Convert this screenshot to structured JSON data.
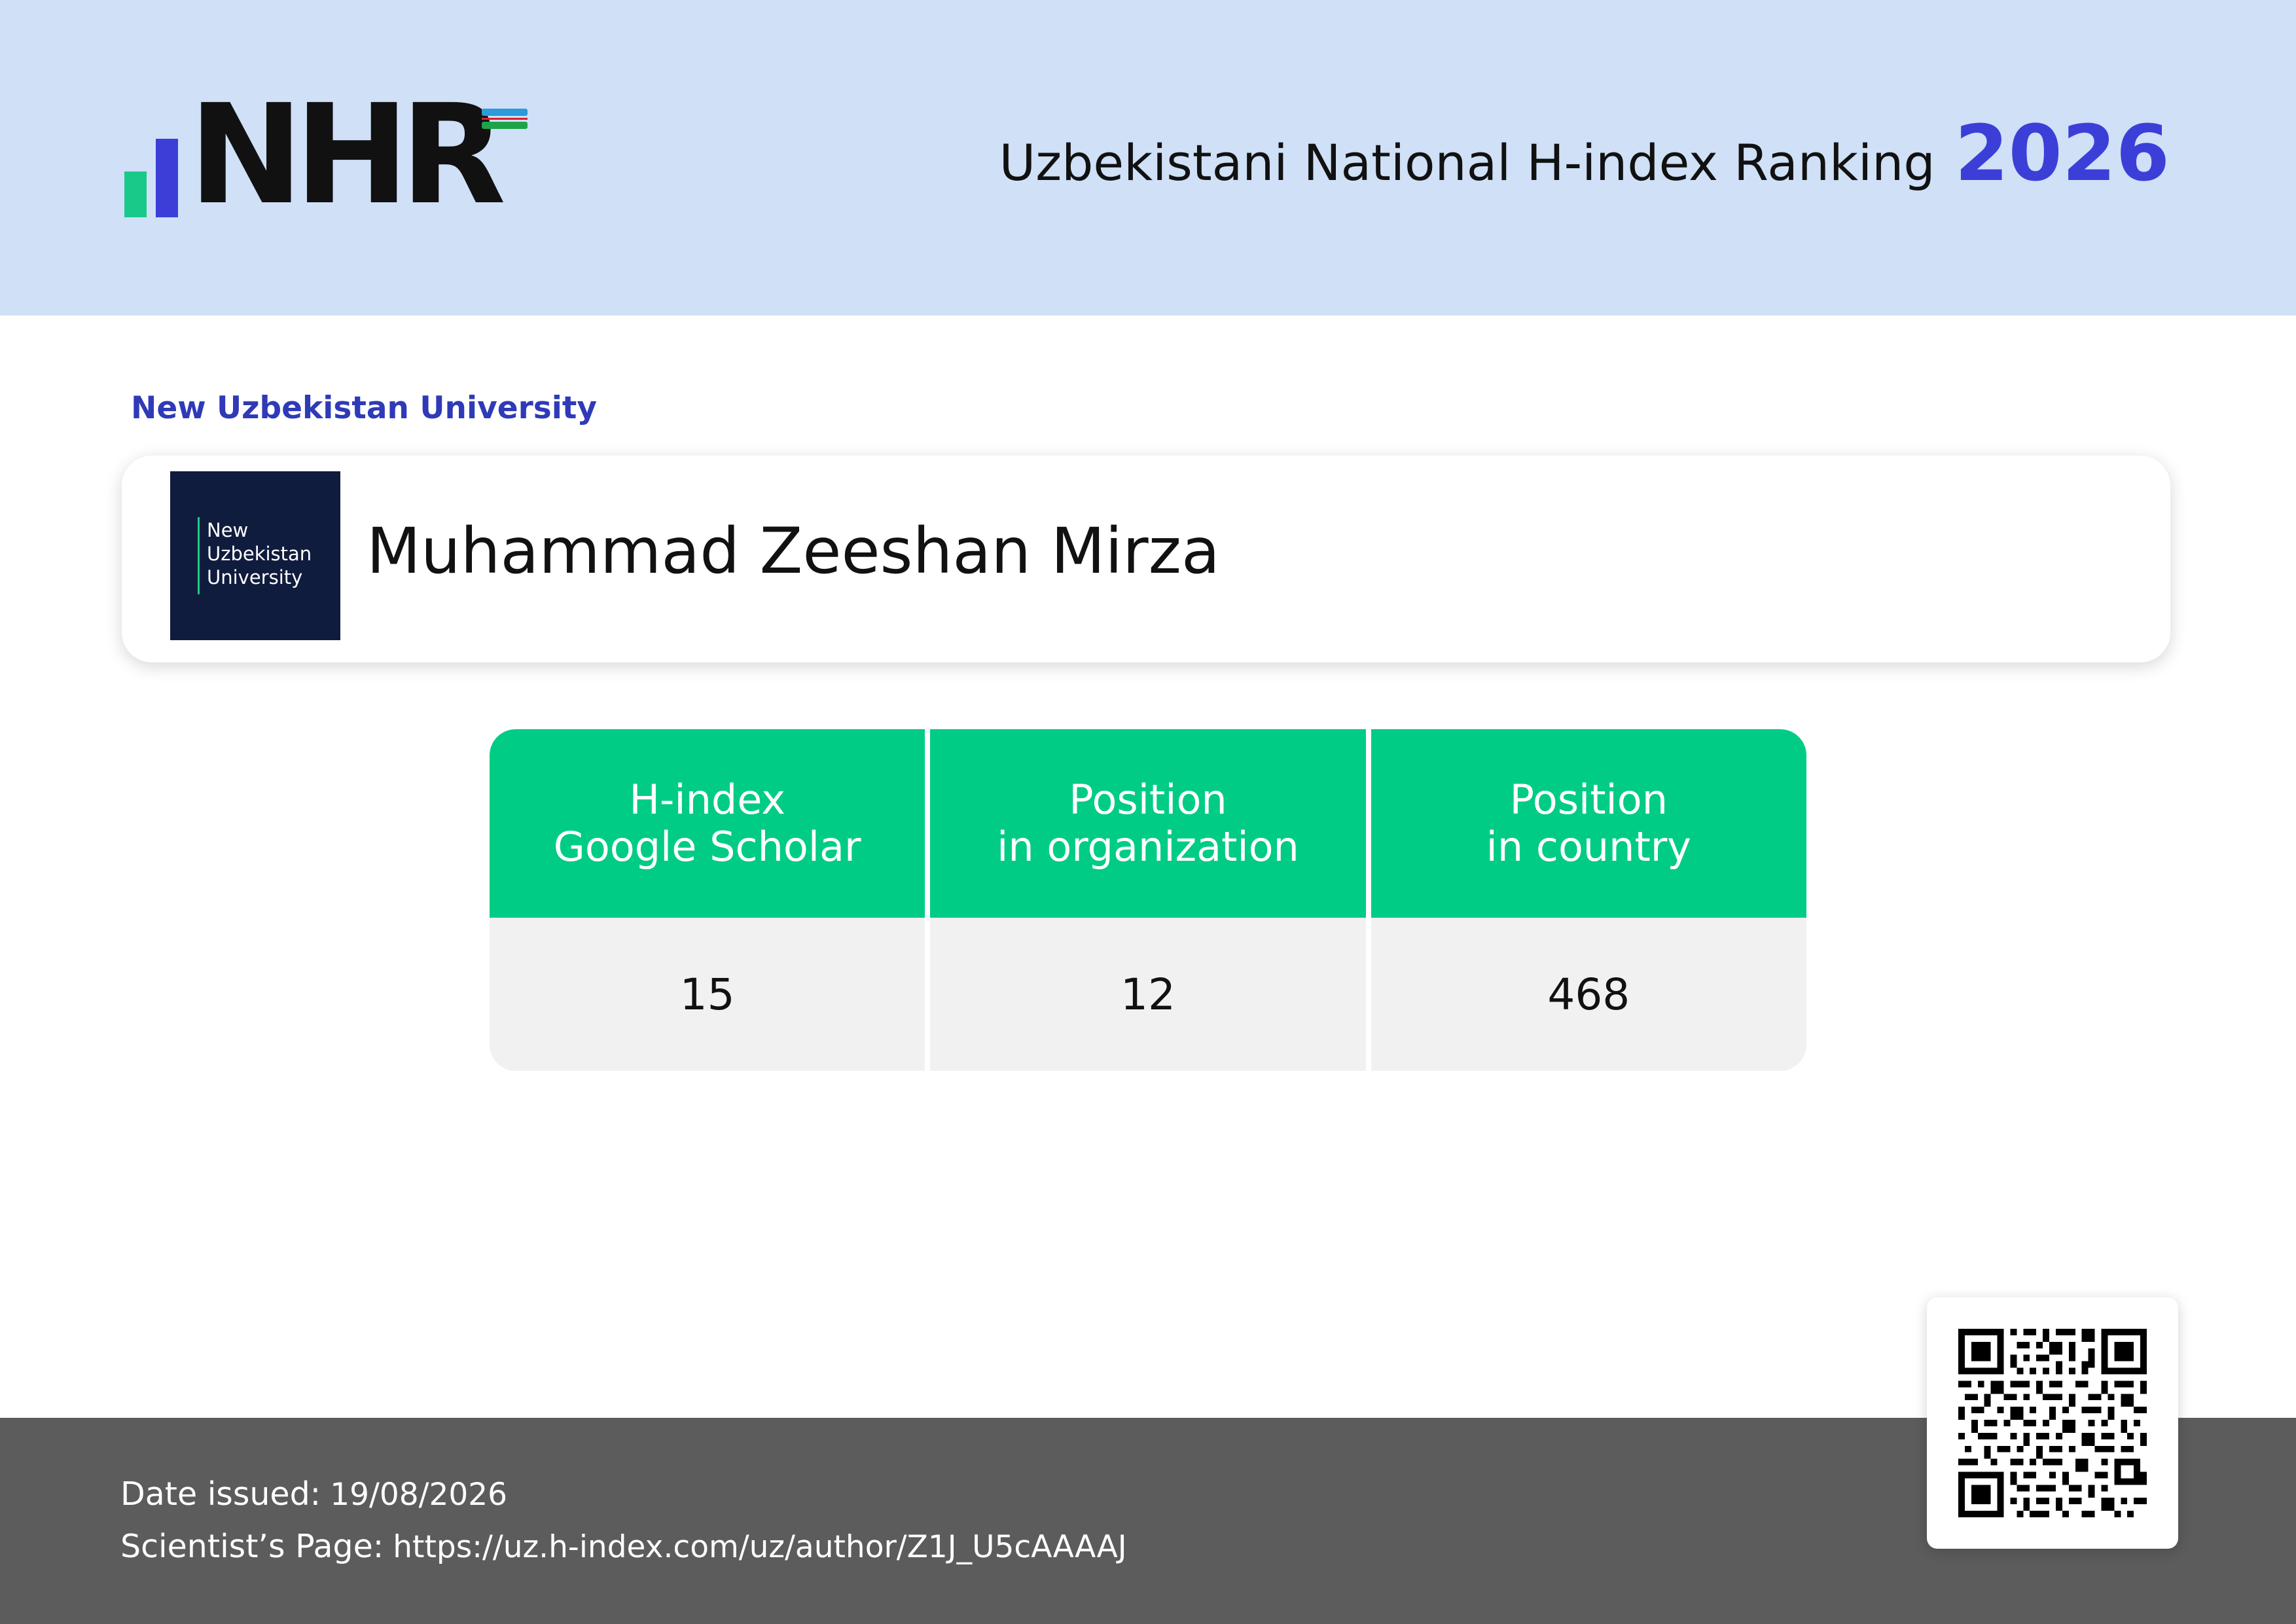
{
  "header": {
    "logo_text": "NHR",
    "title": "Uzbekistani National H-index Ranking",
    "year": "2026"
  },
  "organization": {
    "label": "New Uzbekistan University",
    "logo_lines": [
      "New",
      "Uzbekistan",
      "University"
    ]
  },
  "scientist": {
    "name": "Muhammad Zeeshan Mirza"
  },
  "stats": [
    {
      "header_lines": [
        "H-index",
        "Google Scholar"
      ],
      "value": "15"
    },
    {
      "header_lines": [
        "Position",
        "in organization"
      ],
      "value": "12"
    },
    {
      "header_lines": [
        "Position",
        "in country"
      ],
      "value": "468"
    }
  ],
  "footer": {
    "date_label": "Date issued:",
    "date_value": "19/08/2026",
    "page_label": "Scientist’s Page:",
    "page_value": "https://uz.h-index.com/uz/author/Z1J_U5cAAAAJ"
  },
  "colors": {
    "header_bg": "#cfe0f7",
    "accent_blue": "#3b3fd8",
    "accent_green": "#00cc86",
    "footer_bg": "#5c5c5c",
    "org_logo_bg": "#101c3d"
  }
}
